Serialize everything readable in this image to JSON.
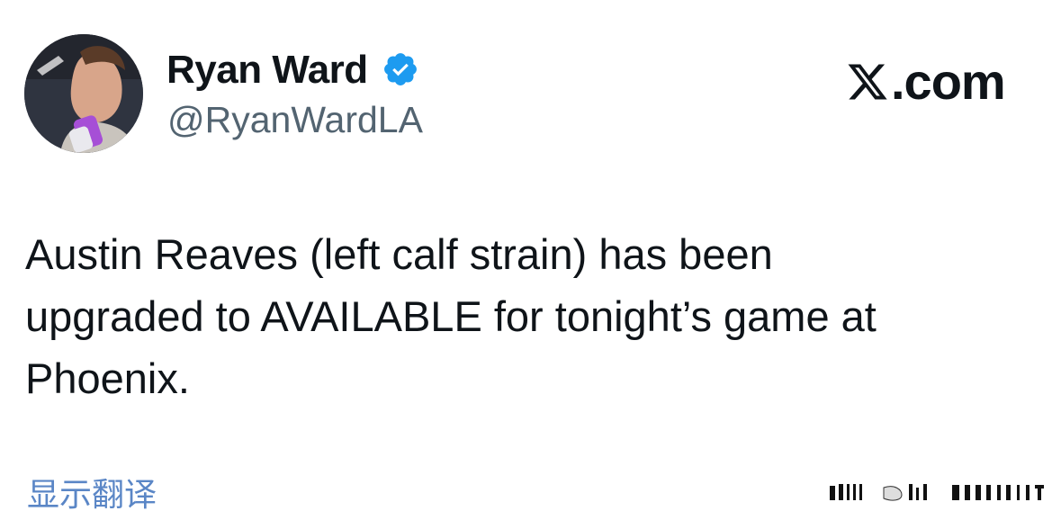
{
  "author": {
    "display_name": "Ryan Ward",
    "handle": "@RyanWardLA",
    "verified": true,
    "avatar_icon": "avatar-photo"
  },
  "brand": {
    "text": ".com",
    "icon": "x-logo-icon"
  },
  "tweet": {
    "text": "Austin Reaves (left calf strain) has been\nupgraded to AVAILABLE for tonight’s game at\nPhoenix."
  },
  "translate": {
    "label": "显示翻译"
  },
  "colors": {
    "verified_blue": "#1d9bf0",
    "handle_gray": "#536471",
    "link_blue": "#5a86c6"
  }
}
